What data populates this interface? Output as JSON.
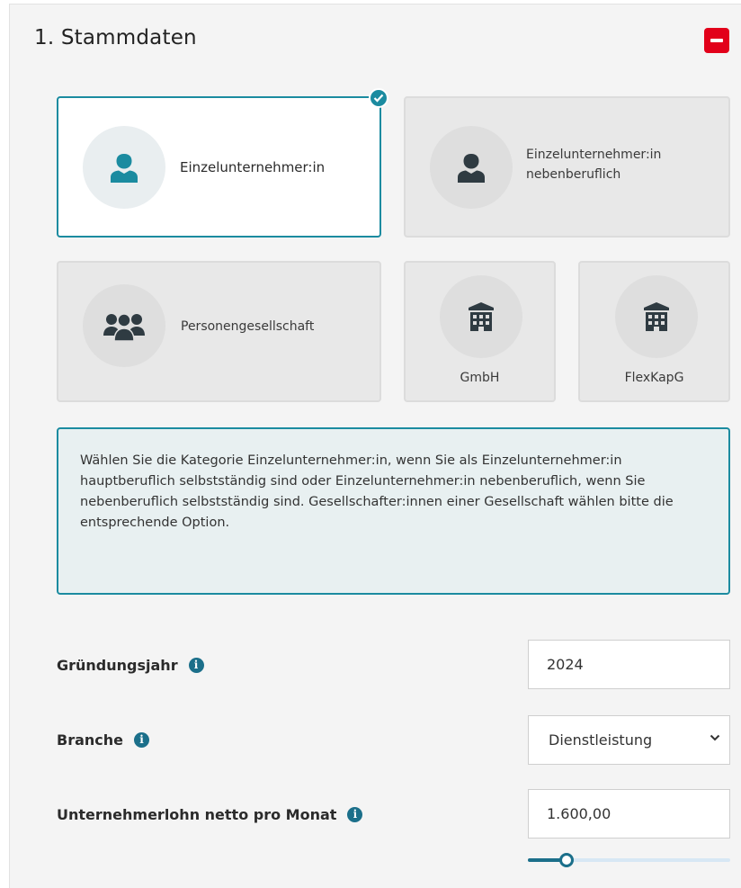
{
  "section": {
    "title": "1. Stammdaten",
    "collapse_icon": "minus-icon"
  },
  "categories": {
    "cards": [
      {
        "label": "Einzelunternehmer:in",
        "icon": "person-icon",
        "selected": true
      },
      {
        "label": "Einzelunternehmer:in nebenberuflich",
        "icon": "person-icon",
        "selected": false
      },
      {
        "label": "Personengesellschaft",
        "icon": "group-icon",
        "selected": false
      },
      {
        "label": "GmbH",
        "icon": "building-icon",
        "selected": false
      },
      {
        "label": "FlexKapG",
        "icon": "building-icon",
        "selected": false
      }
    ],
    "info_text": "Wählen Sie die Kategorie Einzelunternehmer:in, wenn Sie als Einzelunternehmer:in hauptberuflich selbstständig sind oder Einzelunternehmer:in nebenberuflich, wenn Sie nebenberuflich selbstständig sind. Gesellschafter:innen einer Gesellschaft wählen bitte die entsprechende Option."
  },
  "fields": {
    "gruendungsjahr": {
      "label": "Gründungsjahr",
      "value": "2024"
    },
    "branche": {
      "label": "Branche",
      "value": "Dienstleistung"
    },
    "unternehmerlohn": {
      "label": "Unternehmerlohn netto pro Monat",
      "value": "1.600,00",
      "slider_fraction": 0.19
    }
  },
  "colors": {
    "accent": "#1b8ba0",
    "info_icon": "#1b6f8a",
    "collapse_button": "#e2001a"
  }
}
